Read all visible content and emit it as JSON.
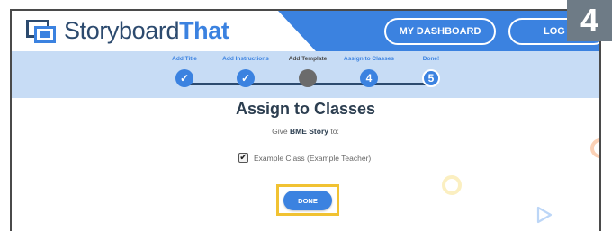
{
  "header": {
    "brand_part1": "Storyboard",
    "brand_part2": "That",
    "dashboard_label": "MY DASHBOARD",
    "logout_label": "LOG O"
  },
  "progress": {
    "steps": [
      {
        "label": "Add Title",
        "marker": "✓",
        "state": "done"
      },
      {
        "label": "Add Instructions",
        "marker": "✓",
        "state": "done"
      },
      {
        "label": "Add Template",
        "marker": "",
        "state": "current"
      },
      {
        "label": "Assign to Classes",
        "marker": "4",
        "state": "done"
      },
      {
        "label": "Done!",
        "marker": "5",
        "state": "future"
      }
    ]
  },
  "main": {
    "title": "Assign to Classes",
    "give_prefix": "Give",
    "story_name": "BME Story",
    "give_suffix": "to:",
    "class_checkbox_mark": "✔",
    "class_label": "Example Class (Example Teacher)",
    "class_checked": true,
    "done_label": "DONE"
  },
  "badge": {
    "text": "4"
  },
  "colors": {
    "brand_blue": "#3b82e0",
    "brand_navy": "#2c4a6e",
    "progress_bg": "#c7dcf5",
    "highlight_yellow": "#f1c232",
    "badge_gray": "#6e7b86"
  }
}
